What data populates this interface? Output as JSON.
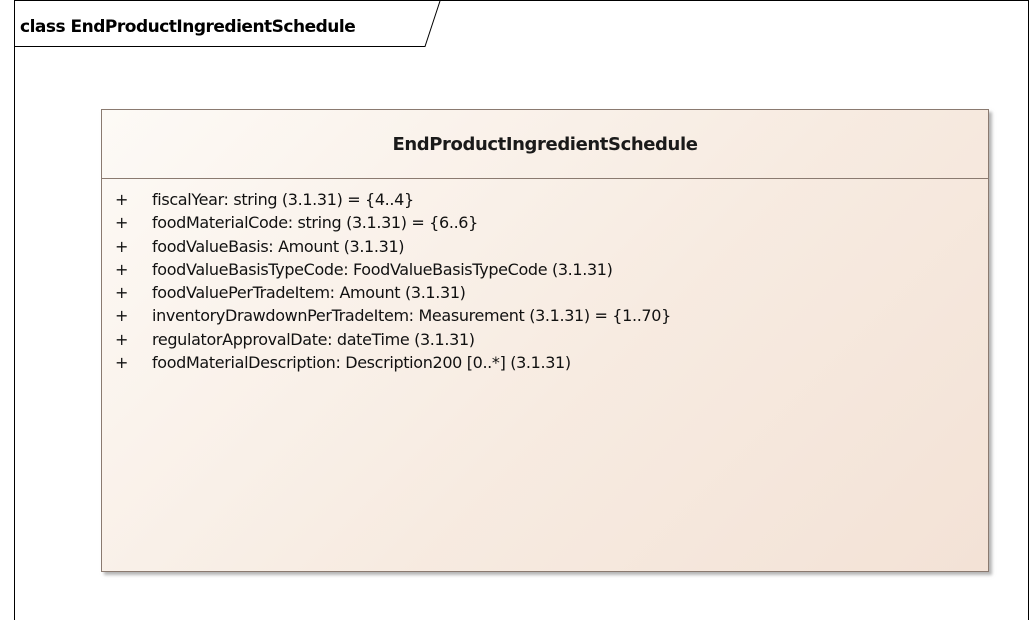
{
  "frame": {
    "title": "class EndProductIngredientSchedule"
  },
  "class": {
    "name": "EndProductIngredientSchedule",
    "attributes": [
      {
        "visibility": "+",
        "text": "fiscalYear: string (3.1.31) = {4..4}"
      },
      {
        "visibility": "+",
        "text": "foodMaterialCode: string (3.1.31) = {6..6}"
      },
      {
        "visibility": "+",
        "text": "foodValueBasis: Amount (3.1.31)"
      },
      {
        "visibility": "+",
        "text": "foodValueBasisTypeCode: FoodValueBasisTypeCode (3.1.31)"
      },
      {
        "visibility": "+",
        "text": "foodValuePerTradeItem: Amount (3.1.31)"
      },
      {
        "visibility": "+",
        "text": "inventoryDrawdownPerTradeItem: Measurement (3.1.31) = {1..70}"
      },
      {
        "visibility": "+",
        "text": "regulatorApprovalDate: dateTime (3.1.31)"
      },
      {
        "visibility": "+",
        "text": "foodMaterialDescription: Description200 [0..*] (3.1.31)"
      }
    ]
  },
  "colors": {
    "box_fill_start": "#fdfaf6",
    "box_fill_end": "#f3e2d6",
    "box_border": "#8a7a70"
  }
}
